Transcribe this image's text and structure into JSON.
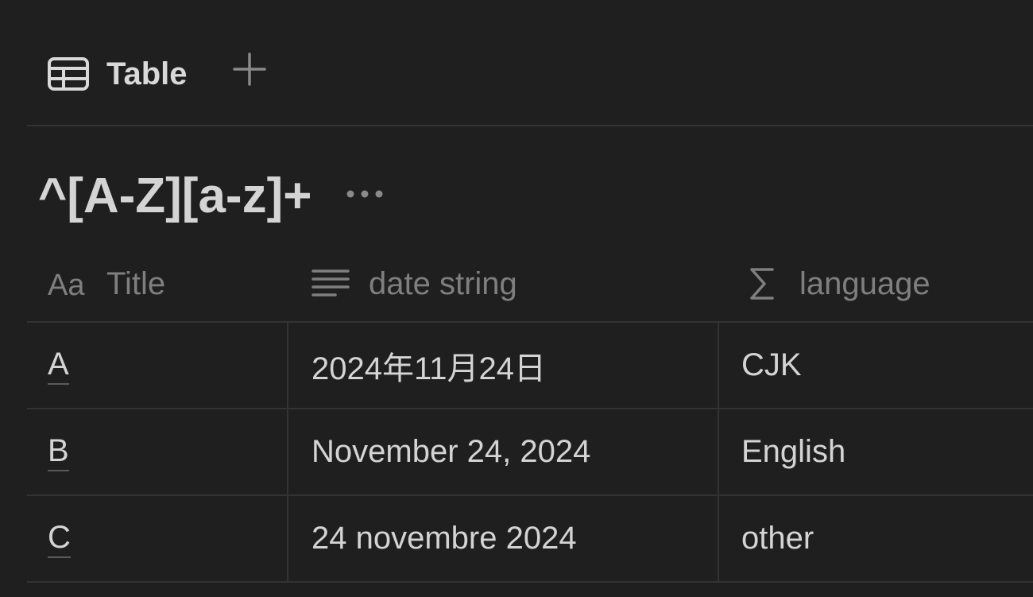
{
  "view_bar": {
    "active_tab": {
      "label": "Table",
      "icon": "table-icon"
    },
    "add_view": {
      "icon": "plus-icon"
    }
  },
  "database": {
    "title": "^[A-Z][a-z]+",
    "more_icon": "more-horizontal-icon"
  },
  "table": {
    "columns": [
      {
        "label": "Title",
        "icon": "text-aa-icon"
      },
      {
        "label": "date string",
        "icon": "text-lines-icon"
      },
      {
        "label": "language",
        "icon": "sigma-formula-icon"
      }
    ],
    "rows": [
      {
        "title": "A",
        "date_string": "2024年11月24日",
        "language": "CJK"
      },
      {
        "title": "B",
        "date_string": "November 24, 2024",
        "language": "English"
      },
      {
        "title": "C",
        "date_string": "24 novembre 2024",
        "language": "other"
      }
    ]
  },
  "colors": {
    "background": "#1f1f1f",
    "divider": "#333333",
    "text_primary": "#d4d4d4",
    "text_muted": "#7f7f7f"
  }
}
